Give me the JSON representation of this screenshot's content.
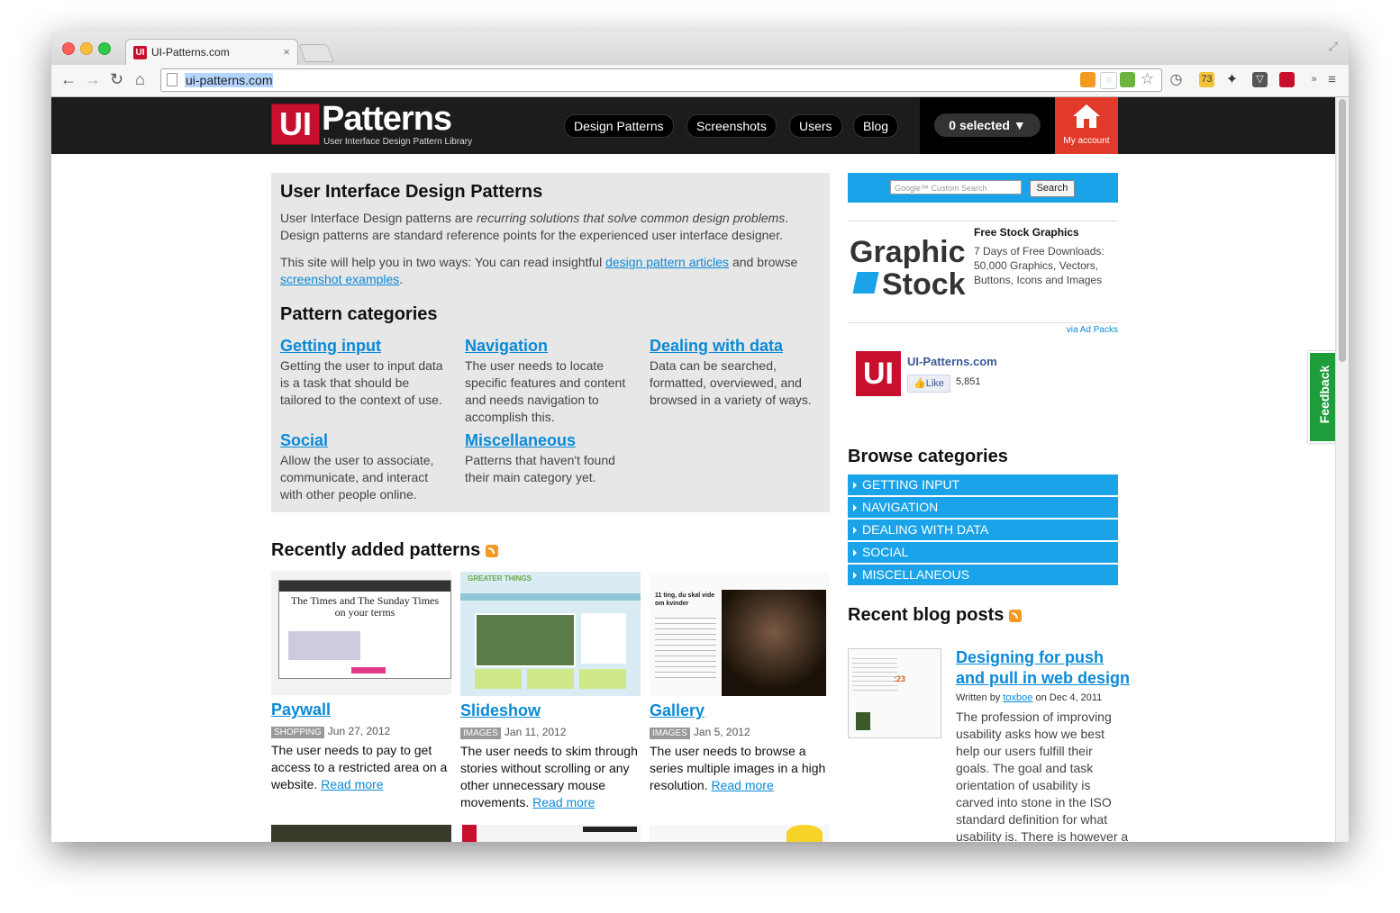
{
  "browser": {
    "tab_title": "UI-Patterns.com",
    "tab_favicon": "UI",
    "url": "ui-patterns.com"
  },
  "header": {
    "logo_mark": "UI",
    "logo_word": "Patterns",
    "logo_tagline": "User Interface Design Pattern Library",
    "nav": [
      "Design Patterns",
      "Screenshots",
      "Users",
      "Blog"
    ],
    "selected_label": "0 selected ▼",
    "account_label": "My account",
    "account_color": "#e23a2a"
  },
  "intro": {
    "title": "User Interface Design Patterns",
    "p1_a": "User Interface Design patterns are ",
    "p1_em": "recurring solutions that solve common design problems",
    "p1_b": ". Design patterns are standard reference points for the experienced user interface designer.",
    "p2_a": "This site will help you in two ways: You can read insightful ",
    "p2_link1": "design pattern articles",
    "p2_b": " and browse ",
    "p2_link2": "screenshot examples",
    "p2_c": ".",
    "categories_title": "Pattern categories",
    "categories": [
      {
        "title": "Getting input",
        "desc": "Getting the user to input data is a task that should be tailored to the context of use."
      },
      {
        "title": "Navigation",
        "desc": "The user needs to locate specific features and content and needs navigation to accomplish this."
      },
      {
        "title": "Dealing with data",
        "desc": "Data can be searched, formatted, overviewed, and browsed in a variety of ways."
      },
      {
        "title": "Social",
        "desc": "Allow the user to associate, communicate, and interact with other people online."
      },
      {
        "title": "Miscellaneous",
        "desc": "Patterns that haven't found their main category yet."
      }
    ]
  },
  "recent": {
    "title": "Recently added patterns",
    "read_more": "Read more",
    "items": [
      {
        "title": "Paywall",
        "tag": "SHOPPING",
        "date": "Jun 27, 2012",
        "desc": "The user needs to pay to get access to a restricted area on a website. ",
        "thumb_heading": "The Times and The Sunday Times on your terms"
      },
      {
        "title": "Slideshow",
        "tag": "IMAGES",
        "date": "Jan 11, 2012",
        "desc": "The user needs to skim through stories without scrolling or any other unnecessary mouse movements. ",
        "thumb_heading": "GREATER THINGS"
      },
      {
        "title": "Gallery",
        "tag": "IMAGES",
        "date": "Jan 5, 2012",
        "desc": "The user needs to browse a series multiple images in a high resolution. ",
        "thumb_heading": "11 ting, du skal vide om kvinder"
      }
    ]
  },
  "sidebar": {
    "search_placeholder": "Google™ Custom Search",
    "search_button": "Search",
    "ad_logo_line1": "Graphic",
    "ad_logo_line2": "Stock",
    "ad_title": "Free Stock Graphics",
    "ad_text": "7 Days of Free Downloads: 50,000 Graphics, Vectors, Buttons, Icons and Images",
    "ad_via": "via Ad Packs",
    "fb_mark": "UI",
    "fb_name": "UI-Patterns.com",
    "fb_like": "Like",
    "fb_count": "5,851",
    "browse_title": "Browse categories",
    "browse": [
      "GETTING INPUT",
      "NAVIGATION",
      "DEALING WITH DATA",
      "SOCIAL",
      "MISCELLANEOUS"
    ],
    "blog_title": "Recent blog posts",
    "blog_post_title": "Designing for push and pull in web design",
    "blog_written_by": "Written by ",
    "blog_author": "toxboe",
    "blog_date": " on Dec 4, 2011",
    "blog_excerpt": "The profession of improving usability asks how we best help our users fulfill their goals. The goal and task orientation of usability is carved into stone in the ISO standard definition for what usability is. There is however a part of the usability profession that can't be concerned with a clear goal"
  },
  "feedback_label": "Feedback",
  "colors": {
    "accent": "#1aa3e8",
    "brand": "#c8102e",
    "feedback": "#1e9e3a",
    "link": "#0a8ad8"
  }
}
